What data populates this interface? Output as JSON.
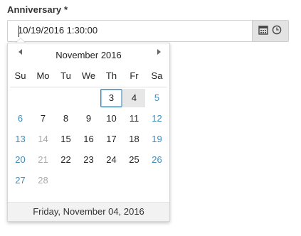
{
  "field": {
    "label": "Anniversary *",
    "value": "10/19/2016 1:30:00"
  },
  "icons": {
    "calendar": "calendar-icon",
    "clock": "clock-icon"
  },
  "calendar": {
    "month_title": "November 2016",
    "weekdays": [
      "Su",
      "Mo",
      "Tu",
      "We",
      "Th",
      "Fr",
      "Sa"
    ],
    "weeks": [
      [
        {
          "label": "",
          "state": "empty"
        },
        {
          "label": "",
          "state": "empty"
        },
        {
          "label": "",
          "state": "empty"
        },
        {
          "label": "",
          "state": "empty"
        },
        {
          "label": "3",
          "state": "today"
        },
        {
          "label": "4",
          "state": "selected"
        },
        {
          "label": "5",
          "state": "weekend"
        }
      ],
      [
        {
          "label": "6",
          "state": "weekend"
        },
        {
          "label": "7",
          "state": "normal"
        },
        {
          "label": "8",
          "state": "normal"
        },
        {
          "label": "9",
          "state": "normal"
        },
        {
          "label": "10",
          "state": "normal"
        },
        {
          "label": "11",
          "state": "normal"
        },
        {
          "label": "12",
          "state": "weekend"
        }
      ],
      [
        {
          "label": "13",
          "state": "weekend"
        },
        {
          "label": "14",
          "state": "other"
        },
        {
          "label": "15",
          "state": "normal"
        },
        {
          "label": "16",
          "state": "normal"
        },
        {
          "label": "17",
          "state": "normal"
        },
        {
          "label": "18",
          "state": "normal"
        },
        {
          "label": "19",
          "state": "weekend"
        }
      ],
      [
        {
          "label": "20",
          "state": "weekend"
        },
        {
          "label": "21",
          "state": "other"
        },
        {
          "label": "22",
          "state": "normal"
        },
        {
          "label": "23",
          "state": "normal"
        },
        {
          "label": "24",
          "state": "normal"
        },
        {
          "label": "25",
          "state": "normal"
        },
        {
          "label": "26",
          "state": "weekend"
        }
      ],
      [
        {
          "label": "27",
          "state": "weekend"
        },
        {
          "label": "28",
          "state": "other"
        },
        {
          "label": "",
          "state": "empty"
        },
        {
          "label": "",
          "state": "empty"
        },
        {
          "label": "",
          "state": "empty"
        },
        {
          "label": "",
          "state": "empty"
        },
        {
          "label": "",
          "state": "empty"
        }
      ]
    ],
    "footer": "Friday, November 04, 2016"
  },
  "colors": {
    "weekend": "#3c8dbc",
    "disabled": "#aaaaaa",
    "addon_bg": "#e3e3e3",
    "selected_bg": "#e7e7e7",
    "footer_bg": "#f2f2f2"
  }
}
